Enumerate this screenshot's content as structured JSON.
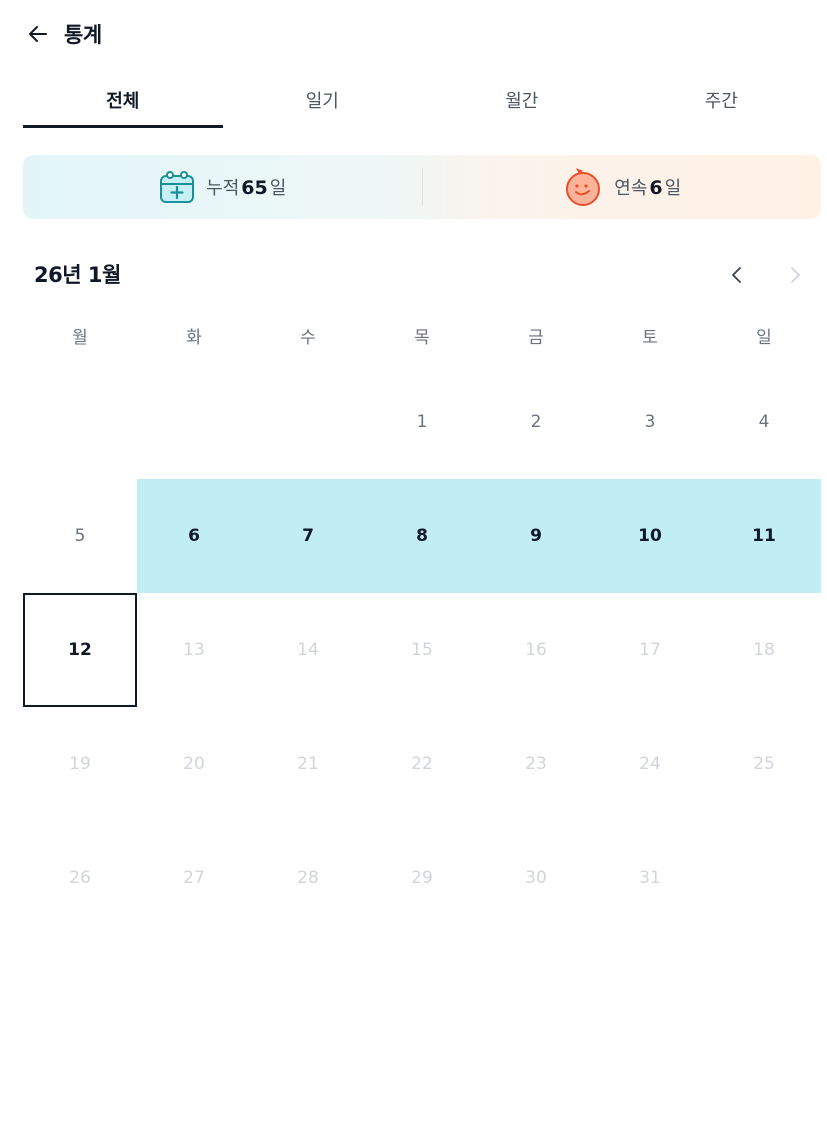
{
  "header": {
    "title": "통계"
  },
  "tabs": [
    {
      "label": "전체",
      "active": true
    },
    {
      "label": "일기",
      "active": false
    },
    {
      "label": "월간",
      "active": false
    },
    {
      "label": "주간",
      "active": false
    }
  ],
  "stats": {
    "cumulative": {
      "label": "누적",
      "value": "65",
      "unit": "일",
      "icon": "calendar-plus-icon"
    },
    "streak": {
      "label": "연속",
      "value": "6",
      "unit": "일",
      "icon": "smiley-face-icon"
    }
  },
  "calendar": {
    "month_label": "26년 1월",
    "weekdays": [
      "월",
      "화",
      "수",
      "목",
      "금",
      "토",
      "일"
    ],
    "weeks": [
      [
        "",
        "",
        "",
        "1",
        "2",
        "3",
        "4"
      ],
      [
        "5",
        "6",
        "7",
        "8",
        "9",
        "10",
        "11"
      ],
      [
        "12",
        "13",
        "14",
        "15",
        "16",
        "17",
        "18"
      ],
      [
        "19",
        "20",
        "21",
        "22",
        "23",
        "24",
        "25"
      ],
      [
        "26",
        "27",
        "28",
        "29",
        "30",
        "31",
        ""
      ]
    ],
    "streak_days": [
      "6",
      "7",
      "8",
      "9",
      "10",
      "11"
    ],
    "today": "12",
    "colors": {
      "streak_highlight": "#c1eef3",
      "today_border": "#111827",
      "future_text": "#d1d5db"
    }
  }
}
